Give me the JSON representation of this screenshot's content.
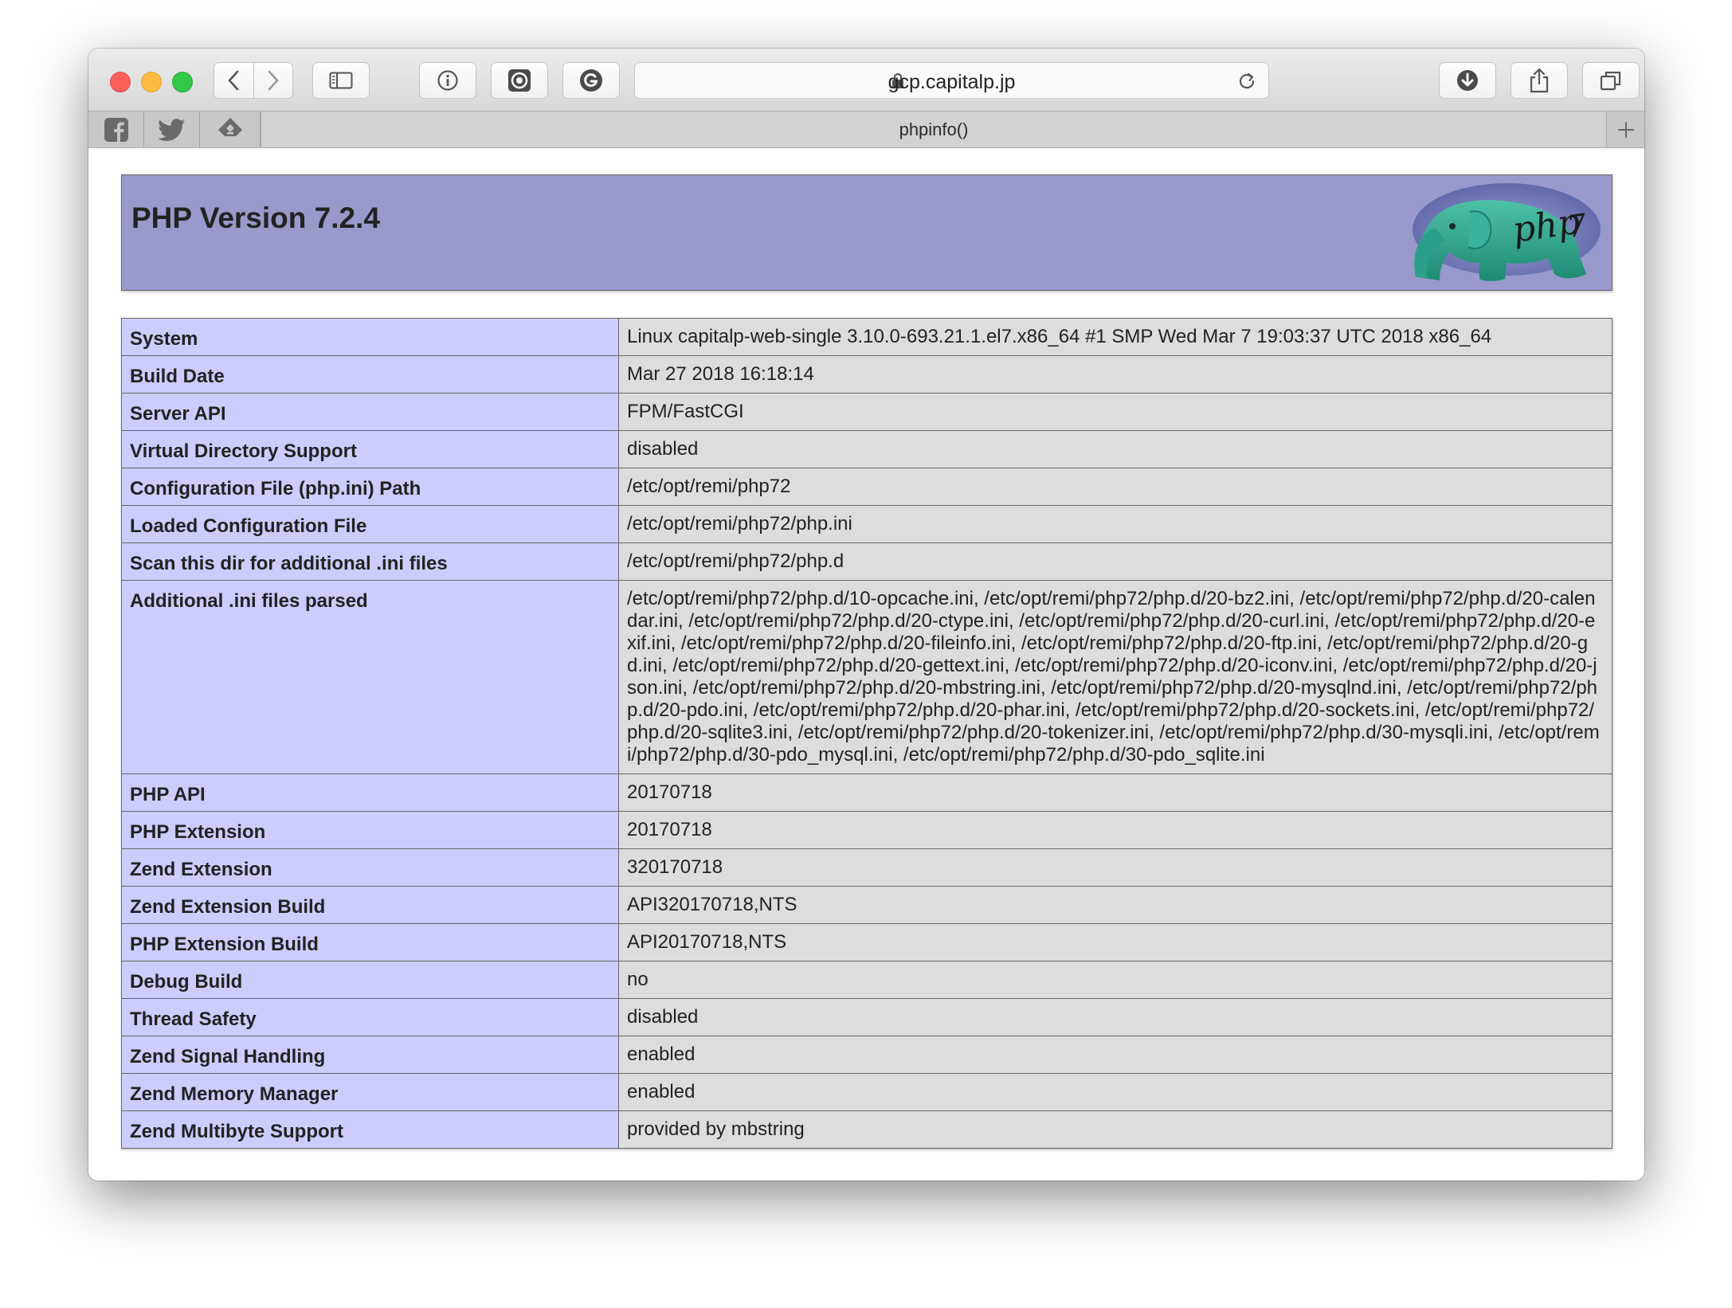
{
  "browser": {
    "url": "gcp.capitalp.jp",
    "tab_title": "phpinfo()"
  },
  "page": {
    "version_title": "PHP Version 7.2.4",
    "logo_icon": "php-elephant-logo",
    "rows": [
      {
        "key": "System",
        "value": "Linux capitalp-web-single 3.10.0-693.21.1.el7.x86_64 #1 SMP Wed Mar 7 19:03:37 UTC 2018 x86_64"
      },
      {
        "key": "Build Date",
        "value": "Mar 27 2018 16:18:14"
      },
      {
        "key": "Server API",
        "value": "FPM/FastCGI"
      },
      {
        "key": "Virtual Directory Support",
        "value": "disabled"
      },
      {
        "key": "Configuration File (php.ini) Path",
        "value": "/etc/opt/remi/php72"
      },
      {
        "key": "Loaded Configuration File",
        "value": "/etc/opt/remi/php72/php.ini"
      },
      {
        "key": "Scan this dir for additional .ini files",
        "value": "/etc/opt/remi/php72/php.d"
      },
      {
        "key": "Additional .ini files parsed",
        "value": "/etc/opt/remi/php72/php.d/10-opcache.ini, /etc/opt/remi/php72/php.d/20-bz2.ini, /etc/opt/remi/php72/php.d/20-calendar.ini, /etc/opt/remi/php72/php.d/20-ctype.ini, /etc/opt/remi/php72/php.d/20-curl.ini, /etc/opt/remi/php72/php.d/20-exif.ini, /etc/opt/remi/php72/php.d/20-fileinfo.ini, /etc/opt/remi/php72/php.d/20-ftp.ini, /etc/opt/remi/php72/php.d/20-gd.ini, /etc/opt/remi/php72/php.d/20-gettext.ini, /etc/opt/remi/php72/php.d/20-iconv.ini, /etc/opt/remi/php72/php.d/20-json.ini, /etc/opt/remi/php72/php.d/20-mbstring.ini, /etc/opt/remi/php72/php.d/20-mysqlnd.ini, /etc/opt/remi/php72/php.d/20-pdo.ini, /etc/opt/remi/php72/php.d/20-phar.ini, /etc/opt/remi/php72/php.d/20-sockets.ini, /etc/opt/remi/php72/php.d/20-sqlite3.ini, /etc/opt/remi/php72/php.d/20-tokenizer.ini, /etc/opt/remi/php72/php.d/30-mysqli.ini, /etc/opt/remi/php72/php.d/30-pdo_mysql.ini, /etc/opt/remi/php72/php.d/30-pdo_sqlite.ini"
      },
      {
        "key": "PHP API",
        "value": "20170718"
      },
      {
        "key": "PHP Extension",
        "value": "20170718"
      },
      {
        "key": "Zend Extension",
        "value": "320170718"
      },
      {
        "key": "Zend Extension Build",
        "value": "API320170718,NTS"
      },
      {
        "key": "PHP Extension Build",
        "value": "API20170718,NTS"
      },
      {
        "key": "Debug Build",
        "value": "no"
      },
      {
        "key": "Thread Safety",
        "value": "disabled"
      },
      {
        "key": "Zend Signal Handling",
        "value": "enabled"
      },
      {
        "key": "Zend Memory Manager",
        "value": "enabled"
      },
      {
        "key": "Zend Multibyte Support",
        "value": "provided by mbstring"
      }
    ]
  },
  "colors": {
    "header_bg": "#9999cc",
    "key_cell_bg": "#ccccff",
    "value_cell_bg": "#dddddd",
    "border": "#666666"
  }
}
